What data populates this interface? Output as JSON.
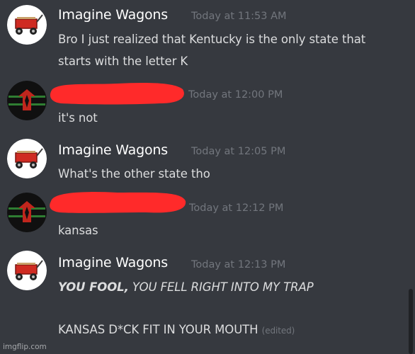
{
  "messages": [
    {
      "author": "Imagine Wagons",
      "timestamp": "Today at 11:53 AM",
      "lines": [
        "Bro I just realized that Kentucky is the only state that",
        "starts with the letter K"
      ]
    },
    {
      "author": "",
      "timestamp": "Today at 12:00 PM",
      "lines": [
        "it's not"
      ]
    },
    {
      "author": "Imagine Wagons",
      "timestamp": "Today at 12:05 PM",
      "lines": [
        "What's the other state tho"
      ]
    },
    {
      "author": "",
      "timestamp": "Today at 12:12 PM",
      "lines": [
        "kansas"
      ]
    },
    {
      "author": "Imagine Wagons",
      "timestamp": "Today at 12:13 PM",
      "line1_bold": "YOU FOOL,",
      "line1_rest": " YOU FELL RIGHT INTO MY TRAP",
      "line2": "KANSAS D*CK FIT IN YOUR MOUTH",
      "edited": "(edited)"
    }
  ],
  "icons": {
    "wagon_avatar": "red-wagon-icon",
    "redacted_avatar": "black-eagle-emblem-icon"
  },
  "colors": {
    "background": "#36393f",
    "username": "#ffffff",
    "message_text": "#dcddde",
    "timestamp": "#72767d",
    "redaction": "#ff2a2a"
  },
  "watermark": "imgflip.com"
}
